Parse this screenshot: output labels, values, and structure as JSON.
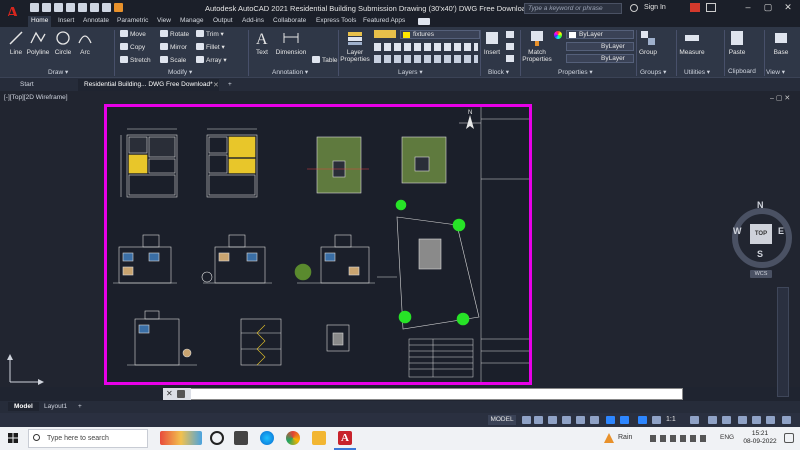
{
  "app": {
    "title": "Autodesk AutoCAD 2021    Residential Building Submission Drawing (30'x40') DWG Free Download.dwg",
    "logo": "A",
    "search_placeholder": "Type a keyword or phrase",
    "sign_in": "Sign In"
  },
  "ribbon_tabs": [
    "Home",
    "Insert",
    "Annotate",
    "Parametric",
    "View",
    "Manage",
    "Output",
    "Add-ins",
    "Collaborate",
    "Express Tools",
    "Featured Apps"
  ],
  "ribbon": {
    "draw": {
      "title": "Draw ▾",
      "line": "Line",
      "polyline": "Polyline",
      "circle": "Circle",
      "arc": "Arc"
    },
    "modify": {
      "title": "Modify ▾",
      "move": "Move",
      "rotate": "Rotate",
      "trim": "Trim ▾",
      "copy": "Copy",
      "mirror": "Mirror",
      "fillet": "Fillet ▾",
      "stretch": "Stretch",
      "scale": "Scale",
      "array": "Array ▾"
    },
    "annotation": {
      "title": "Annotation ▾",
      "text": "Text",
      "dimension": "Dimension",
      "table": "Table"
    },
    "layers": {
      "title": "Layers ▾",
      "layer_properties": "Layer Properties",
      "current_layer": "fixtures"
    },
    "block": {
      "title": "Block ▾",
      "insert": "Insert"
    },
    "properties": {
      "title": "Properties ▾",
      "match": "Match Properties",
      "color": "ByLayer",
      "linetype": "ByLayer",
      "lineweight": "ByLayer"
    },
    "groups": {
      "title": "Groups ▾",
      "group": "Group"
    },
    "utilities": {
      "title": "Utilities ▾",
      "measure": "Measure"
    },
    "clipboard": {
      "title": "Clipboard",
      "paste": "Paste"
    },
    "view": {
      "title": "View ▾",
      "base": "Base"
    }
  },
  "doc_tabs": {
    "start": "Start",
    "active": "Residential Building... DWG Free Download*",
    "add": "+"
  },
  "viewport_label": "[-][Top][2D Wireframe]",
  "viewcube": {
    "face": "TOP",
    "n": "N",
    "s": "S",
    "e": "E",
    "w": "W",
    "wcs": "WCS"
  },
  "drawing": {
    "north": "N"
  },
  "command": {
    "close": "✕",
    "prompt": ""
  },
  "layout_tabs": [
    "Model",
    "Layout1",
    "+"
  ],
  "status": {
    "model": "MODEL",
    "scale": "1:1"
  },
  "taskbar": {
    "search": "Type here to search",
    "weather": "Rain",
    "lang": "ENG",
    "time": "15:21",
    "date": "08-09-2022"
  },
  "colors": {
    "accent": "#e800e8",
    "brand": "#d7261e",
    "canvas": "#212530",
    "ribbon": "#2f3747"
  }
}
